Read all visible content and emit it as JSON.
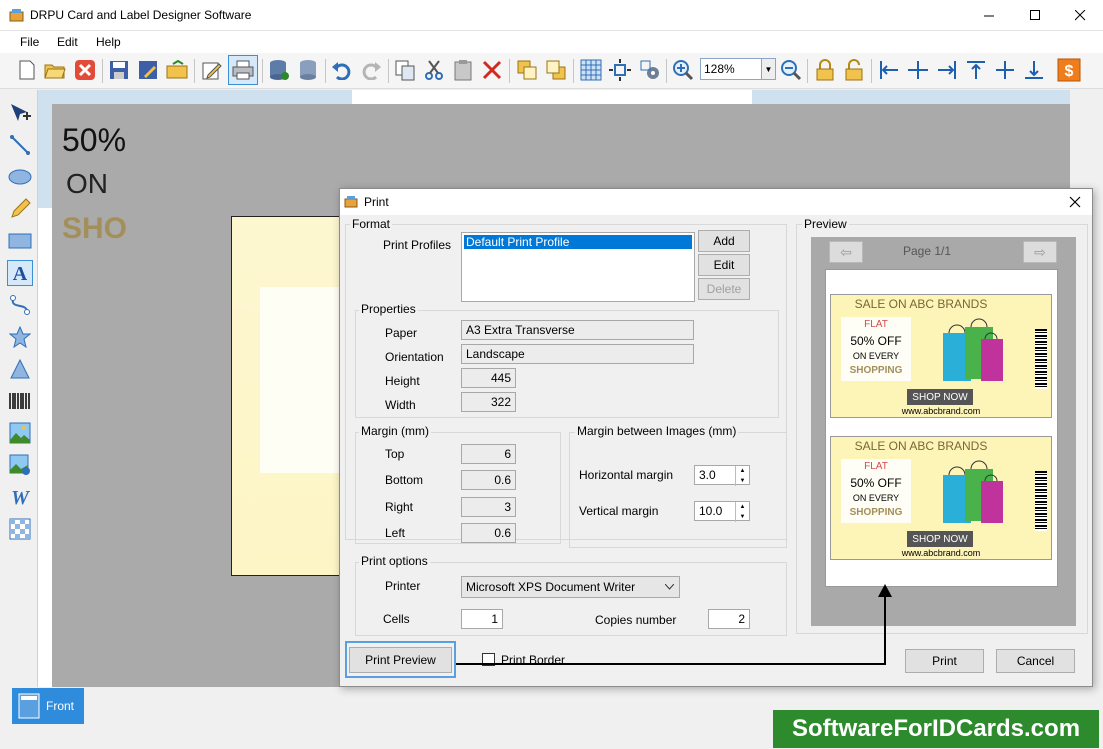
{
  "window": {
    "title": "DRPU Card and Label Designer Software"
  },
  "menu": {
    "file": "File",
    "edit": "Edit",
    "help": "Help"
  },
  "toolbar": {
    "zoom": "128%"
  },
  "canvas": {
    "line1": "50%",
    "line2": "ON",
    "line3": "SHO"
  },
  "bottom": {
    "front_tab": "Front",
    "watermark": "SoftwareForIDCards.com"
  },
  "dialog": {
    "title": "Print",
    "format": {
      "label": "Format",
      "profiles_label": "Print Profiles",
      "profiles": [
        "Default Print Profile"
      ],
      "add": "Add",
      "edit": "Edit",
      "delete": "Delete"
    },
    "properties": {
      "label": "Properties",
      "paper_label": "Paper",
      "paper": "A3 Extra Transverse",
      "orientation_label": "Orientation",
      "orientation": "Landscape",
      "height_label": "Height",
      "height": "445",
      "width_label": "Width",
      "width": "322"
    },
    "margin": {
      "label": "Margin (mm)",
      "top_label": "Top",
      "top": "6",
      "bottom_label": "Bottom",
      "bottom": "0.6",
      "right_label": "Right",
      "right": "3",
      "left_label": "Left",
      "left": "0.6"
    },
    "between": {
      "label": "Margin between Images (mm)",
      "horizontal_label": "Horizontal margin",
      "horizontal": "3.0",
      "vertical_label": "Vertical margin",
      "vertical": "10.0"
    },
    "options": {
      "label": "Print options",
      "printer_label": "Printer",
      "printer": "Microsoft XPS Document Writer",
      "cells_label": "Cells",
      "cells": "1",
      "copies_label": "Copies number",
      "copies": "2"
    },
    "preview": {
      "label": "Preview",
      "page": "Page 1/1",
      "card": {
        "head": "SALE ON ABC BRANDS",
        "flat": "FLAT",
        "off": "50% OFF",
        "every": "ON EVERY",
        "shop": "SHOPPING",
        "shopnow": "SHOP NOW",
        "url": "www.abcbrand.com"
      }
    },
    "buttons": {
      "print_preview": "Print Preview",
      "print_border": "Print Border",
      "print": "Print",
      "cancel": "Cancel"
    }
  }
}
